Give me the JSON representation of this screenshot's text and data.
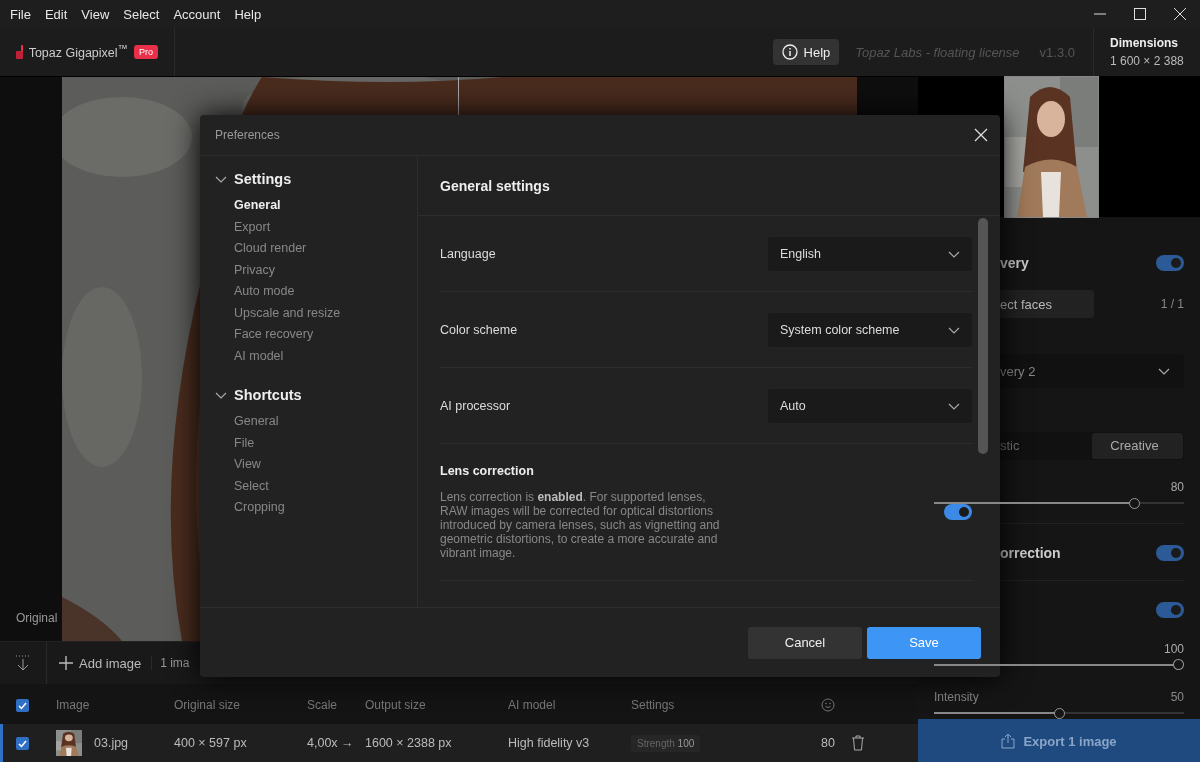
{
  "menu": [
    "File",
    "Edit",
    "View",
    "Select",
    "Account",
    "Help"
  ],
  "header": {
    "app_name": "Topaz Gigapixel$^{™}$",
    "badge": "Pro",
    "help": "Help",
    "license": "Topaz Labs - floating license",
    "version": "v1.3.0",
    "dimensions_label": "Dimensions",
    "dimensions": "1 600 × 2 388"
  },
  "canvas": {
    "label": "Original"
  },
  "toolbar": {
    "add": "Add image",
    "count": "1 ima"
  },
  "table": {
    "select_all_checked": true,
    "columns": [
      "Image",
      "Original size",
      "Scale",
      "Output size",
      "AI model",
      "Settings"
    ],
    "rows": [
      {
        "checked": true,
        "selected": true,
        "name": "03.jpg",
        "original_size": "400 × 597 px",
        "scale": "4,00x",
        "scale_arrow": "→",
        "output_size": "1600 × 2388 px",
        "ai_model": "High fidelity v3",
        "strength_label": "Strength",
        "strength": "100",
        "score": "80"
      }
    ]
  },
  "panel": {
    "face_title": "very",
    "face_on": true,
    "detect": "ect faces",
    "face_count": "1 / 1",
    "model": "very 2",
    "modes": [
      {
        "label": "stic",
        "selected": false
      },
      {
        "label": "Creative",
        "selected": true
      }
    ],
    "strength": {
      "reading": "80",
      "level": 0.8
    },
    "correction_title": "orrection",
    "correction_on": true,
    "third_on": true,
    "slider_2": {
      "reading": "100",
      "level": 1
    },
    "intensity": {
      "label": "Intensity",
      "reading": "50",
      "level": 0.5
    },
    "export": "Export 1 image"
  },
  "dialog": {
    "title": "Preferences",
    "nav": [
      {
        "title": "Settings",
        "expanded": true,
        "items": [
          {
            "label": "General",
            "selected": true
          },
          {
            "label": "Export",
            "selected": false
          },
          {
            "label": "Cloud render",
            "selected": false
          },
          {
            "label": "Privacy",
            "selected": false
          },
          {
            "label": "Auto mode",
            "selected": false
          },
          {
            "label": "Upscale and resize",
            "selected": false
          },
          {
            "label": "Face recovery",
            "selected": false
          },
          {
            "label": "AI model",
            "selected": false
          }
        ]
      },
      {
        "title": "Shortcuts",
        "expanded": true,
        "items": [
          {
            "label": "General",
            "selected": false
          },
          {
            "label": "File",
            "selected": false
          },
          {
            "label": "View",
            "selected": false
          },
          {
            "label": "Select",
            "selected": false
          },
          {
            "label": "Cropping",
            "selected": false
          }
        ]
      }
    ],
    "heading": "General settings",
    "settings": [
      {
        "kind": "select",
        "label": "Language",
        "value": "English"
      },
      {
        "kind": "select",
        "label": "Color scheme",
        "value": "System color scheme"
      },
      {
        "kind": "select",
        "label": "AI processor",
        "value": "Auto"
      },
      {
        "kind": "toggle",
        "label": "Lens correction",
        "description": "Lens correction is **enabled**. For supported lenses, RAW images will be corrected for optical distortions introduced by camera lenses, such as vignetting and geometric distortions, to create a more accurate and vibrant image.",
        "on": true
      }
    ],
    "buttons": [
      {
        "label": "Cancel",
        "kind": "secondary"
      },
      {
        "label": "Save",
        "kind": "primary"
      }
    ]
  }
}
